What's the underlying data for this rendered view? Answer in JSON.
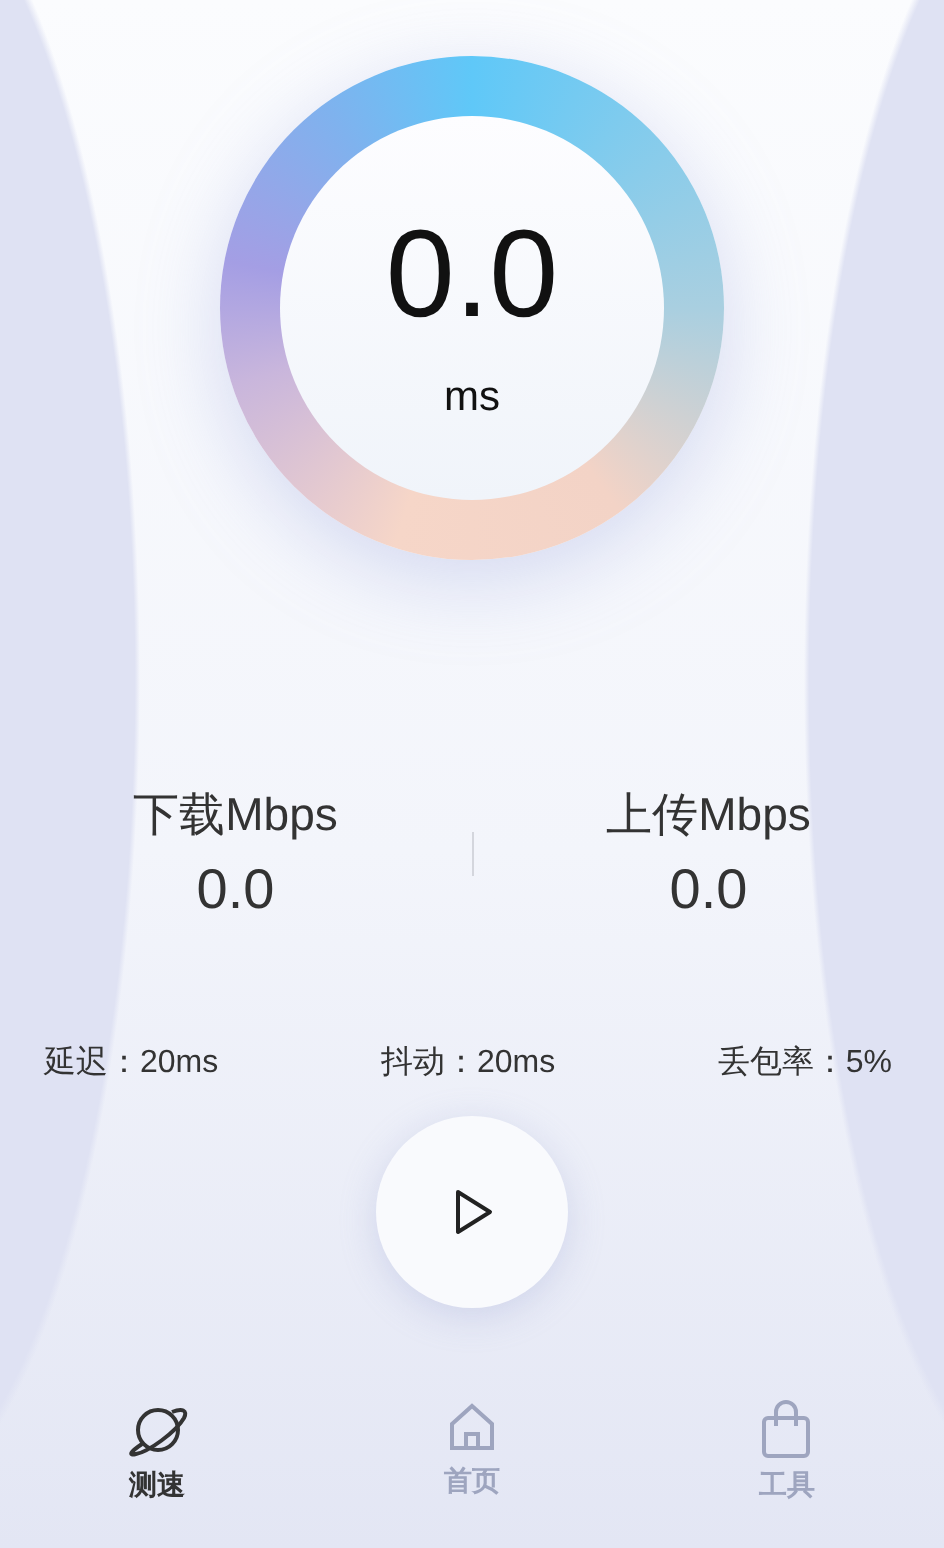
{
  "gauge": {
    "value": "0.0",
    "unit": "ms"
  },
  "speeds": [
    {
      "label": "下载Mbps",
      "value": "0.0"
    },
    {
      "label": "上传Mbps",
      "value": "0.0"
    }
  ],
  "metrics": [
    "延迟：20ms",
    "抖动：20ms",
    "丢包率：5%"
  ],
  "tabs": [
    {
      "label": "测速",
      "selected": true
    },
    {
      "label": "首页",
      "selected": false
    },
    {
      "label": "工具",
      "selected": false
    }
  ]
}
